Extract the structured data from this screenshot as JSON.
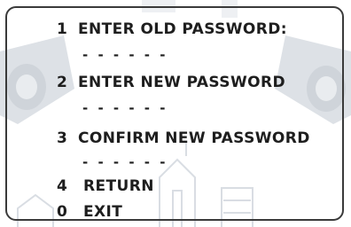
{
  "menu": {
    "items": [
      {
        "number": "1",
        "label": "ENTER OLD PASSWORD:",
        "input_mask": "- - - - - -"
      },
      {
        "number": "2",
        "label": "ENTER NEW PASSWORD",
        "input_mask": "- - - - - -"
      },
      {
        "number": "3",
        "label": "CONFIRM NEW PASSWORD",
        "input_mask": "- - - - - -"
      },
      {
        "number": "4",
        "label": "RETURN"
      },
      {
        "number": "0",
        "label": "EXIT"
      }
    ]
  },
  "background": {
    "watermark_icons": [
      "camera-icon",
      "camera-icon",
      "building-icon"
    ]
  },
  "colors": {
    "text": "#1e1e1e",
    "border": "#3a3a3a",
    "background": "#ffffff",
    "watermark": "#d9dde3"
  }
}
